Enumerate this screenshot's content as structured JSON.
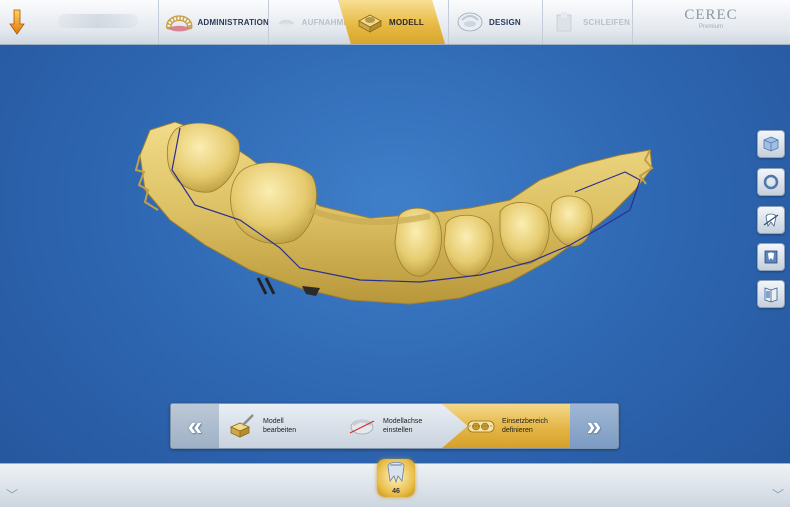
{
  "topbar": {
    "steps": [
      {
        "label": "ADMINISTRATION",
        "state": "done"
      },
      {
        "label": "AUFNAHME",
        "state": "disabled"
      },
      {
        "label": "MODELL",
        "state": "active"
      },
      {
        "label": "DESIGN",
        "state": "done"
      },
      {
        "label": "SCHLEIFEN",
        "state": "disabled"
      }
    ],
    "brand": {
      "title": "CEREC",
      "subtitle": "Premium"
    }
  },
  "right_tools": [
    {
      "icon": "cube-view-icon"
    },
    {
      "icon": "rotate-ring-icon"
    },
    {
      "icon": "tooth-tool-icon"
    },
    {
      "icon": "tooth-slice-icon"
    },
    {
      "icon": "book-icon"
    }
  ],
  "phase_panel": {
    "prev_label": "«",
    "next_label": "»",
    "steps": [
      {
        "line1": "Modell",
        "line2": "bearbeiten",
        "state": "done"
      },
      {
        "line1": "Modellachse",
        "line2": "einstellen",
        "state": "done"
      },
      {
        "line1": "Einsetzbereich",
        "line2": "definieren",
        "state": "active"
      }
    ]
  },
  "bottombar": {
    "tooth_number": "46",
    "left_chevron": "﹀",
    "right_chevron": "﹀"
  },
  "colors": {
    "background": "#2f68b3",
    "active_step": "#e8bb45",
    "model_gold": "#e3c766",
    "margin_line": "#2c2f8f"
  }
}
